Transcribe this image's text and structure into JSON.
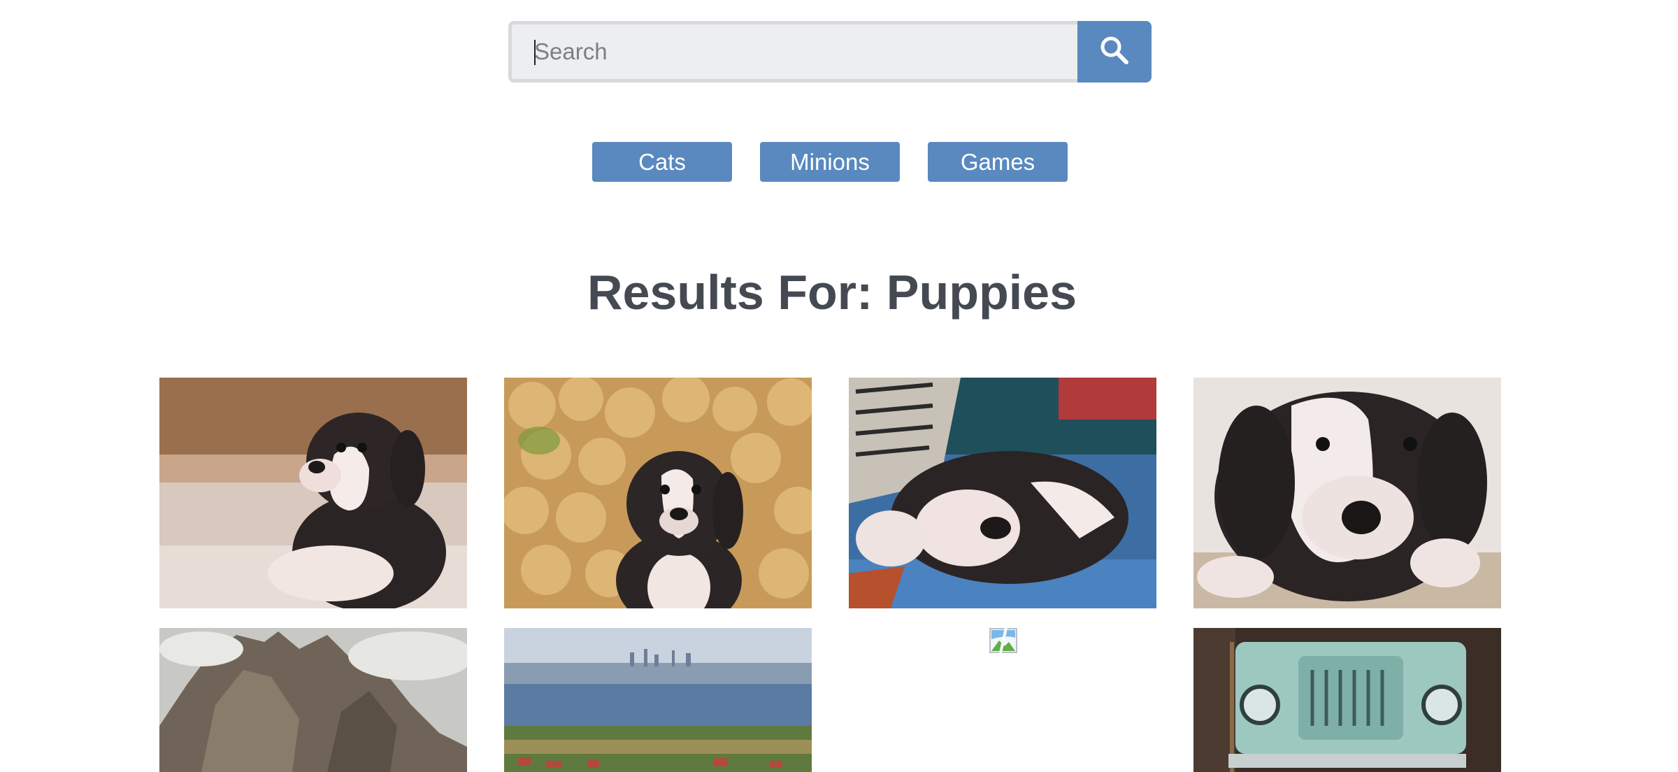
{
  "search": {
    "placeholder": "Search",
    "value": ""
  },
  "categories": [
    "Cats",
    "Minions",
    "Games"
  ],
  "results": {
    "title": "Results For: Puppies"
  },
  "colors": {
    "accent": "#5989bf",
    "title": "#454a52",
    "input_bg": "#edeef0"
  },
  "icons": {
    "search": "search-icon",
    "broken_image": "broken-image-icon"
  },
  "images": [
    {
      "subject": "puppy lying on floor",
      "status": "loaded"
    },
    {
      "subject": "puppy in front of logs",
      "status": "loaded"
    },
    {
      "subject": "puppy sleeping on blanket",
      "status": "loaded"
    },
    {
      "subject": "puppy face close-up",
      "status": "loaded"
    },
    {
      "subject": "rocky mountain",
      "status": "loaded"
    },
    {
      "subject": "city skyline",
      "status": "loaded"
    },
    {
      "subject": "",
      "status": "broken"
    },
    {
      "subject": "vintage green vehicle",
      "status": "loaded"
    }
  ]
}
